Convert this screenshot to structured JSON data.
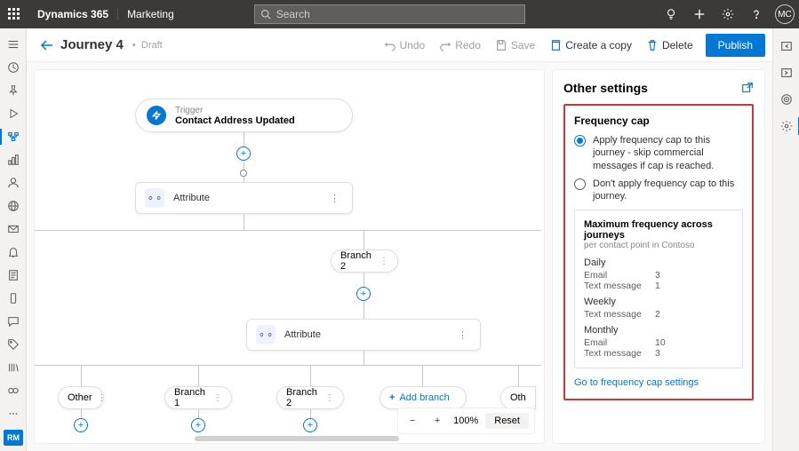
{
  "navbar": {
    "brand": "Dynamics 365",
    "product": "Marketing",
    "search_placeholder": "Search",
    "avatar_initials": "MC"
  },
  "leftrail_badge": "RM",
  "cmdbar": {
    "title": "Journey 4",
    "status": "Draft",
    "undo": "Undo",
    "redo": "Redo",
    "save": "Save",
    "copy": "Create a copy",
    "delete": "Delete",
    "publish": "Publish"
  },
  "canvas": {
    "trigger_label": "Trigger",
    "trigger_name": "Contact Address Updated",
    "attribute_label": "Attribute",
    "branch2": "Branch 2",
    "branch1": "Branch 1",
    "add_branch": "Add branch",
    "other": "Other",
    "oth_short": "Oth"
  },
  "zoom": {
    "level": "100%",
    "reset": "Reset"
  },
  "panel": {
    "title": "Other settings",
    "freq_title": "Frequency cap",
    "opt_apply": "Apply frequency cap to this journey - skip commercial messages if cap is reached.",
    "opt_skip": "Don't apply frequency cap to this journey.",
    "max_title": "Maximum frequency across journeys",
    "max_sub": "per contact point in Contoso",
    "periods": [
      {
        "name": "Daily",
        "rows": [
          {
            "chan": "Email",
            "val": "3"
          },
          {
            "chan": "Text message",
            "val": "1"
          }
        ]
      },
      {
        "name": "Weekly",
        "rows": [
          {
            "chan": "Text message",
            "val": "2"
          }
        ]
      },
      {
        "name": "Monthly",
        "rows": [
          {
            "chan": "Email",
            "val": "10"
          },
          {
            "chan": "Text message",
            "val": "3"
          }
        ]
      }
    ],
    "link": "Go to frequency cap settings"
  }
}
